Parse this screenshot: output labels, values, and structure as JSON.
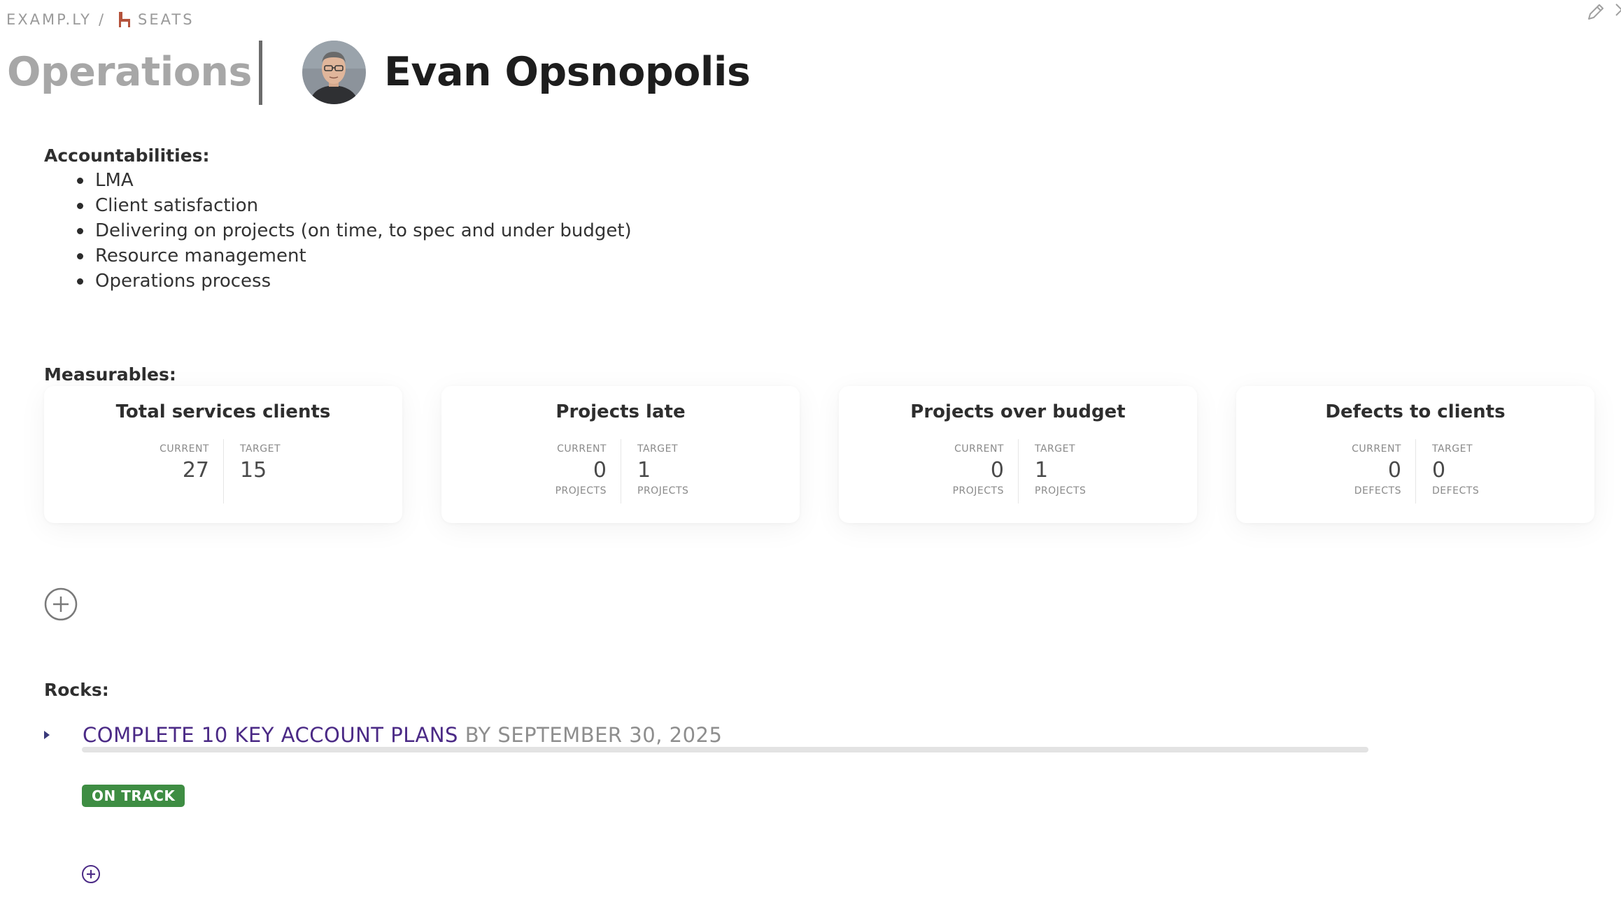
{
  "breadcrumb": {
    "org": "EXAMP.LY",
    "separator": "/",
    "section": "SEATS",
    "section_icon": "chair-icon"
  },
  "toolbar": {
    "edit_icon": "pencil-icon",
    "close_icon": "close-icon"
  },
  "header": {
    "department": "Operations",
    "person": "Evan Opsnopolis",
    "avatar_icon": "avatar"
  },
  "accountabilities": {
    "label": "Accountabilities:",
    "items": [
      "LMA",
      "Client satisfaction",
      "Delivering on projects (on time, to spec and under budget)",
      "Resource management",
      "Operations process"
    ]
  },
  "measurables": {
    "label": "Measurables:",
    "cards": [
      {
        "title": "Total services clients",
        "current_label": "CURRENT",
        "target_label": "TARGET",
        "current": "27",
        "target": "15",
        "unit": ""
      },
      {
        "title": "Projects late",
        "current_label": "CURRENT",
        "target_label": "TARGET",
        "current": "0",
        "target": "1",
        "unit": "PROJECTS"
      },
      {
        "title": "Projects over budget",
        "current_label": "CURRENT",
        "target_label": "TARGET",
        "current": "0",
        "target": "1",
        "unit": "PROJECTS"
      },
      {
        "title": "Defects to clients",
        "current_label": "CURRENT",
        "target_label": "TARGET",
        "current": "0",
        "target": "0",
        "unit": "DEFECTS"
      }
    ],
    "add_icon": "plus-circle-icon"
  },
  "rocks": {
    "label": "Rocks:",
    "items": [
      {
        "title": "COMPLETE 10 KEY ACCOUNT PLANS",
        "due": "BY SEPTEMBER 30, 2025",
        "status": "ON TRACK",
        "progress": 0
      }
    ],
    "add_icon": "plus-circle-icon"
  },
  "colors": {
    "rock_title": "#4b2a86",
    "status_on_track": "#3e8d43",
    "chair_icon": "#b5533c"
  }
}
